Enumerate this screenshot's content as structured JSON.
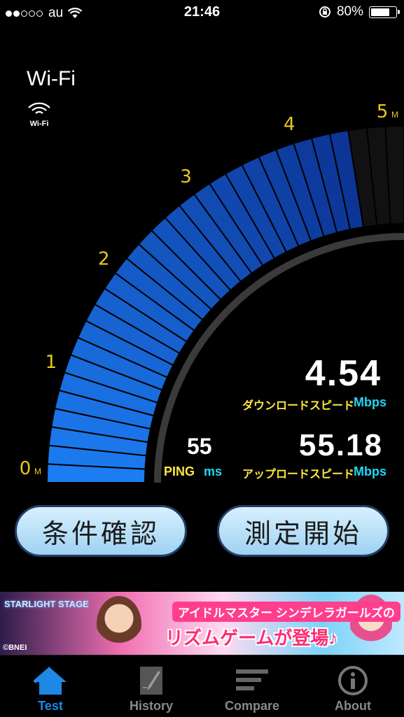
{
  "status_bar": {
    "carrier": "au",
    "time": "21:46",
    "battery": "80%",
    "battery_level": 0.8
  },
  "network": {
    "type": "Wi-Fi",
    "badge_label": "Wi-Fi"
  },
  "gauge": {
    "tick_labels": [
      "0",
      "1",
      "2",
      "3",
      "4",
      "5"
    ],
    "tick_unit": "M",
    "max_mbps": 5,
    "download_value_mbps": 4.54,
    "colors": {
      "fill_light": "#1c7cf1",
      "fill_dark": "#0a2a88",
      "tick": "#e7c91d"
    }
  },
  "results": {
    "download_value": "4.54",
    "download_label": "ダウンロードスピード",
    "download_unit": "Mbps",
    "upload_value": "55.18",
    "upload_label": "アップロードスピード",
    "upload_unit": "Mbps",
    "ping_value": "55",
    "ping_label": "PING",
    "ping_unit": "ms"
  },
  "buttons": {
    "conditions": "条件確認",
    "start": "測定開始"
  },
  "ad_banner": {
    "logo_text": "STARLIGHT STAGE",
    "headline": "アイドルマスター シンデレラガールズの",
    "tagline": "リズムゲームが登場♪",
    "copyright": "©BNEI"
  },
  "tabbar": {
    "tabs": [
      {
        "label": "Test",
        "icon": "home-icon",
        "active": true
      },
      {
        "label": "History",
        "icon": "notepad-icon",
        "active": false
      },
      {
        "label": "Compare",
        "icon": "bars-icon",
        "active": false
      },
      {
        "label": "About",
        "icon": "info-icon",
        "active": false
      }
    ],
    "active_color": "#1e88e5"
  }
}
